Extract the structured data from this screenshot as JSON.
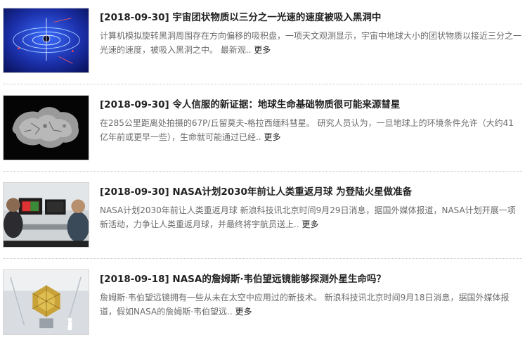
{
  "articles": [
    {
      "date": "[2018-09-30]",
      "title": "宇宙团状物质以三分之一光速的速度被吸入黑洞中",
      "summary": "计算机模拟旋转黑洞周围存在方向偏移的吸积盘，一项天文观测显示，宇宙中地球大小的团状物质以接近三分之一光速的速度，被吸入黑洞之中。 最新观..",
      "more": "更多",
      "thumb_icon": "black-hole-illustration"
    },
    {
      "date": "[2018-09-30]",
      "title": "令人信服的新证据：地球生命基础物质很可能来源彗星",
      "summary": "在285公里距离处拍摄的67P/丘留莫夫-格拉西缅科彗星。 研究人员认为，一旦地球上的环境条件允许（大约41亿年前或更早一些），生命就可能通过已经..",
      "more": "更多",
      "thumb_icon": "comet-photo"
    },
    {
      "date": "[2018-09-30]",
      "title": "NASA计划2030年前让人类重返月球 为登陆火星做准备",
      "summary": "NASA计划2030年前让人类重返月球 新浪科技讯北京时间9月29日消息，据国外媒体报道，NASA计划开展一项新活动，力争让人类重返月球，并最终将宇航员送上..",
      "more": "更多",
      "thumb_icon": "mission-control-photo"
    },
    {
      "date": "[2018-09-18]",
      "title": "NASA的詹姆斯·韦伯望远镜能够探测外星生命吗？",
      "summary": "詹姆斯·韦伯望远镜拥有一些从未在太空中应用过的新技术。 新浪科技讯北京时间9月18日消息，据国外媒体报道，假如NASA的詹姆斯·韦伯望远..",
      "more": "更多",
      "thumb_icon": "telescope-photo"
    }
  ]
}
